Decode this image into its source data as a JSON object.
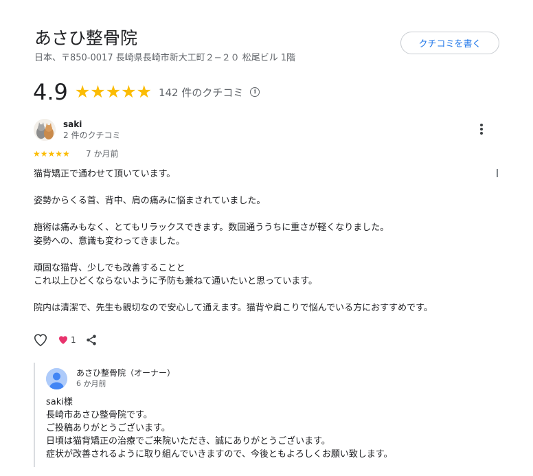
{
  "business": {
    "name": "あさひ整骨院",
    "address": "日本、〒850-0017 長崎県長崎市新大工町２−２０ 松尾ビル 1階"
  },
  "write_review_label": "クチコミを書く",
  "rating": {
    "value": "4.9",
    "stars": "★★★★★",
    "count_text": "142 件のクチコミ",
    "info_icon": "i"
  },
  "review": {
    "reviewer_name": "saki",
    "reviewer_meta": "2 件のクチコミ",
    "stars": "★★★★★",
    "star_rating": 5,
    "time": "7 か月前",
    "paragraphs": [
      "猫背矯正で通わせて頂いています。",
      "",
      "姿勢からくる首、背中、肩の痛みに悩まされていました。",
      "",
      "施術は痛みもなく、とてもリラックスできます。数回通ううちに重さが軽くなりました。",
      "姿勢への、意識も変わってきました。",
      "",
      "頑固な猫背、少しでも改善することと",
      "これ以上ひどくならないように予防も兼ねて通いたいと思っています。",
      "",
      "院内は清潔で、先生も親切なので安心して通えます。猫背や肩こりで悩んでいる方におすすめです。"
    ],
    "like_count": "1"
  },
  "owner_reply": {
    "name": "あさひ整骨院（オーナー）",
    "time": "6 か月前",
    "lines": [
      "saki様",
      "長崎市あさひ整骨院です。",
      "ご投稿ありがとうございます。",
      "日頃は猫背矯正の治療でご来院いただき、誠にありがとうございます。",
      "症状が改善されるように取り組んでいきますので、今後ともよろしくお願い致します。"
    ]
  },
  "colors": {
    "star": "#fbbc04",
    "link_blue": "#1a73e8",
    "heart_pink": "#e8336d",
    "owner_avatar_bg": "#aecbfa",
    "owner_avatar_fg": "#4285f4"
  },
  "icons": {
    "more": "more-vert-icon",
    "like": "heart-outline-icon",
    "reaction": "heart-filled-icon",
    "share": "share-icon",
    "info": "info-icon"
  }
}
